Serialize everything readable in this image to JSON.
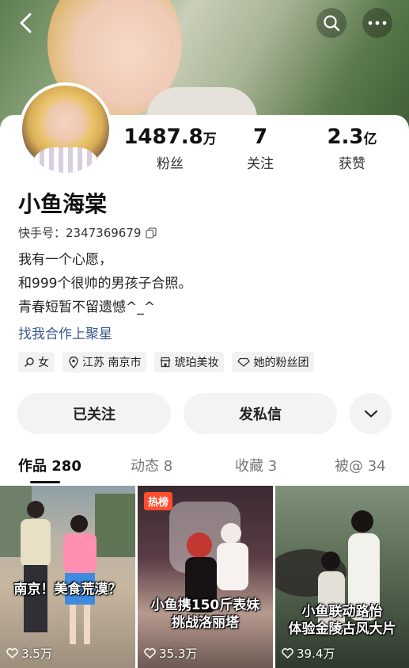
{
  "profile": {
    "name": "小鱼海棠",
    "kuaishou_id": "快手号：2347369679",
    "bio_lines": [
      "我有一个心愿，",
      "和999个很帅的男孩子合照。",
      "青春短暂不留遗憾^_^"
    ],
    "link_text": "找我合作上聚星"
  },
  "stats": [
    {
      "value": "1487.8",
      "unit": "万",
      "label": "粉丝"
    },
    {
      "value": "7",
      "unit": "",
      "label": "关注"
    },
    {
      "value": "2.3",
      "unit": "亿",
      "label": "获赞"
    }
  ],
  "tags": [
    {
      "icon": "female-icon",
      "label": "女"
    },
    {
      "icon": "location-icon",
      "label": "江苏 南京市"
    },
    {
      "icon": "shop-icon",
      "label": "琥珀美妆"
    },
    {
      "icon": "fan-group-icon",
      "label": "她的粉丝团"
    }
  ],
  "actions": {
    "followed_label": "已关注",
    "message_label": "发私信",
    "expand_icon": "chevron-down-icon"
  },
  "tabs": [
    {
      "label": "作品 280",
      "active": true
    },
    {
      "label": "动态 8",
      "active": false
    },
    {
      "label": "收藏 3",
      "active": false
    },
    {
      "label": "被@ 34",
      "active": false
    }
  ],
  "videos": [
    {
      "title": "南京！美食荒漠？",
      "likes": "3.5万",
      "badge": ""
    },
    {
      "title_lines": [
        "小鱼携150斤表妹",
        "挑战洛丽塔"
      ],
      "likes": "35.3万",
      "badge": "热榜"
    },
    {
      "title_lines": [
        "小鱼联动路怡",
        "体验金陵古风大片"
      ],
      "likes": "39.4万",
      "badge": ""
    }
  ],
  "colors": {
    "link": "#3a5a8c",
    "hot_badge": "#ff4d2e",
    "button_bg": "#f3f3f3"
  }
}
